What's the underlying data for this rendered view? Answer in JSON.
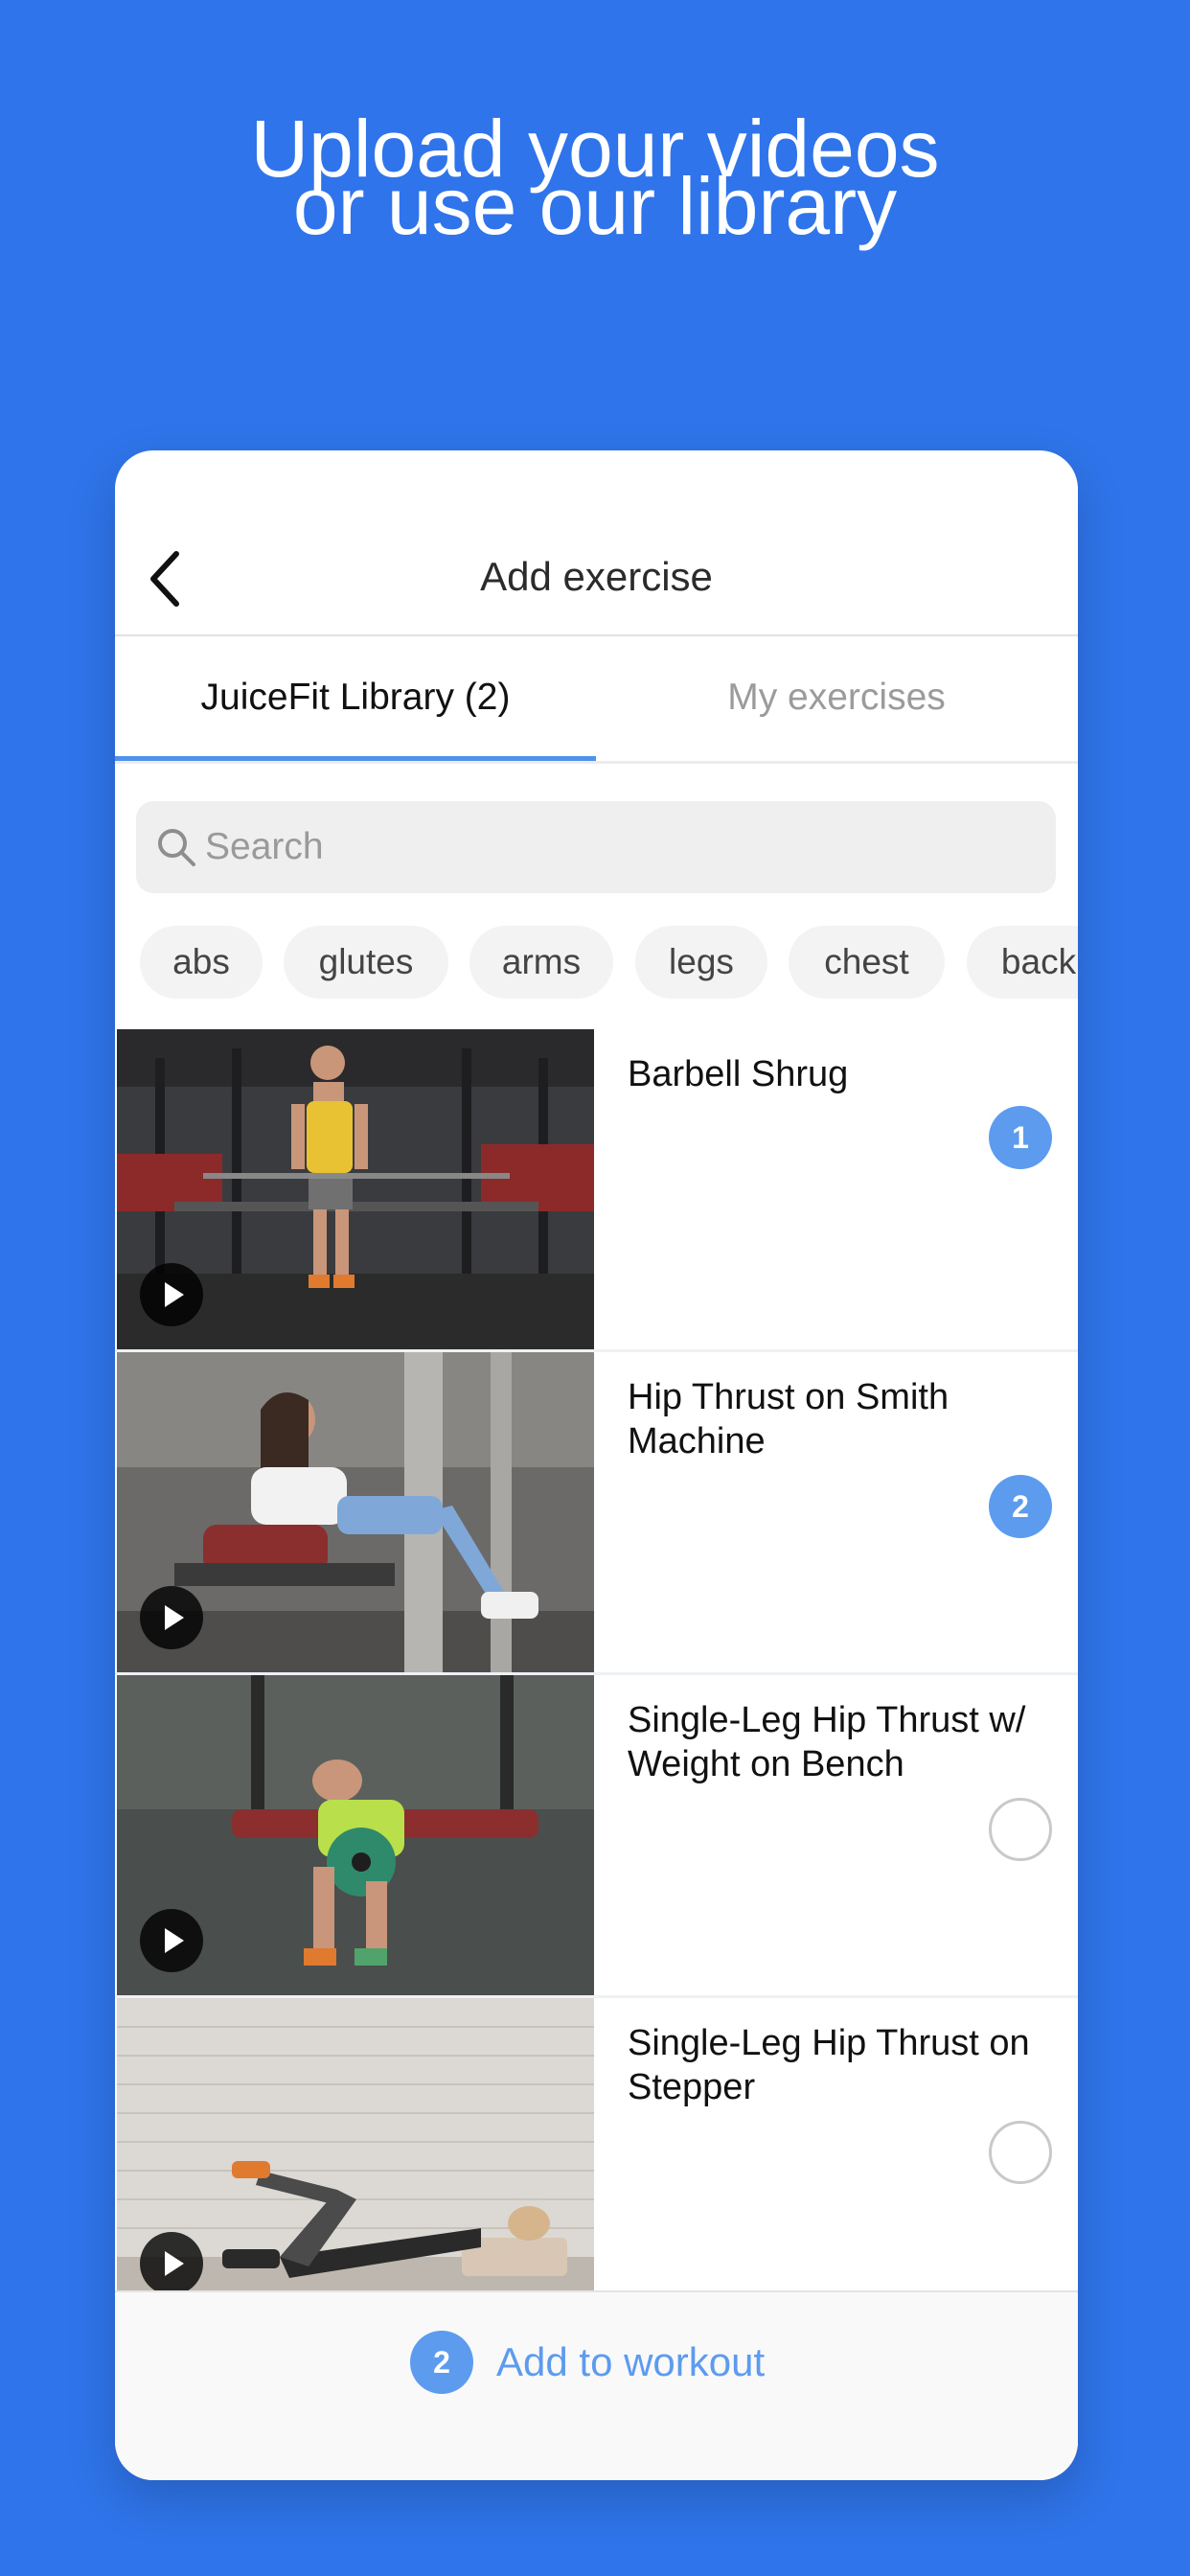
{
  "headline": {
    "line1": "Upload your videos",
    "line2": "or use our library"
  },
  "colors": {
    "background": "#2F74EA",
    "accent": "#5D9BEF",
    "tab_indicator": "#4F92EE"
  },
  "navbar": {
    "title": "Add exercise",
    "back_icon": "chevron-left-icon"
  },
  "tabs": [
    {
      "label": "JuiceFit Library (2)",
      "active": true
    },
    {
      "label": "My exercises",
      "active": false
    }
  ],
  "search": {
    "placeholder": "Search",
    "value": "",
    "icon": "search-icon"
  },
  "chips": [
    "abs",
    "glutes",
    "arms",
    "legs",
    "chest",
    "back"
  ],
  "exercises": [
    {
      "title": "Barbell Shrug",
      "selected": true,
      "order": "1"
    },
    {
      "title": "Hip Thrust on Smith Machine",
      "selected": true,
      "order": "2"
    },
    {
      "title": "Single-Leg Hip Thrust w/ Weight on Bench",
      "selected": false,
      "order": ""
    },
    {
      "title": "Single-Leg Hip Thrust on Stepper",
      "selected": false,
      "order": ""
    }
  ],
  "footer": {
    "count": "2",
    "label": "Add to workout"
  }
}
